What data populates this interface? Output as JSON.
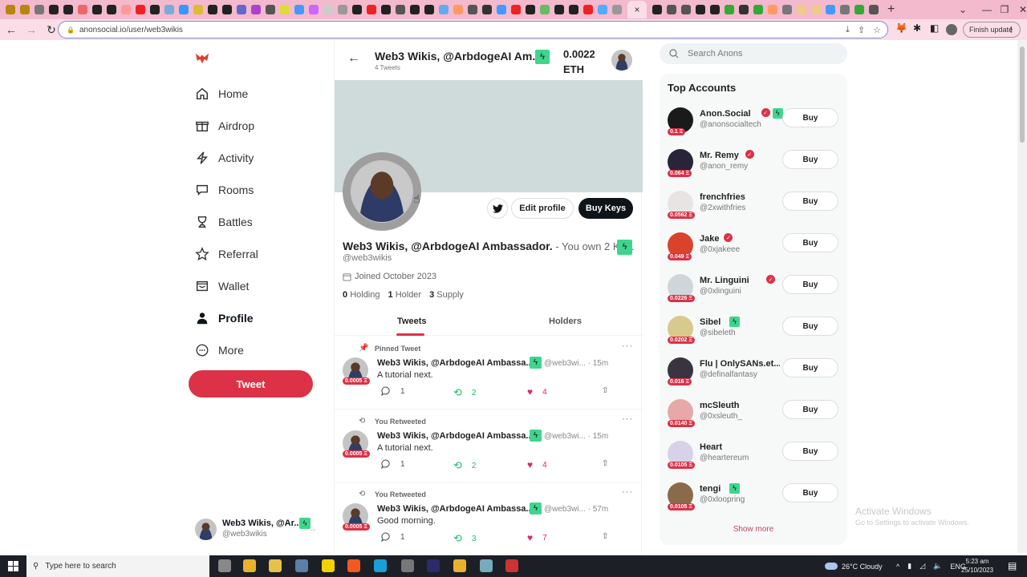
{
  "browser": {
    "url": "anonsocial.io/user/web3wikis",
    "finish_update_label": "Finish update",
    "active_tab_close": "×",
    "new_tab": "+"
  },
  "sidebar": {
    "items": [
      {
        "label": "Home",
        "icon": "home-icon"
      },
      {
        "label": "Airdrop",
        "icon": "gift-icon"
      },
      {
        "label": "Activity",
        "icon": "lightning-icon"
      },
      {
        "label": "Rooms",
        "icon": "chat-bubble-icon"
      },
      {
        "label": "Battles",
        "icon": "trophy-icon"
      },
      {
        "label": "Referral",
        "icon": "star-icon"
      },
      {
        "label": "Wallet",
        "icon": "wallet-icon"
      },
      {
        "label": "Profile",
        "icon": "user-icon",
        "active": true
      },
      {
        "label": "More",
        "icon": "more-circle-icon"
      }
    ],
    "tweet_label": "Tweet",
    "account": {
      "name": "Web3 Wikis, @Ar...",
      "handle": "@web3wikis",
      "more": "..."
    }
  },
  "header": {
    "title": "Web3 Wikis, @ArbdogeAI Am...",
    "subtitle": "4 Tweets",
    "price": "0.0022",
    "currency": "ETH"
  },
  "profile": {
    "edit_label": "Edit profile",
    "buy_keys_label": "Buy Keys",
    "name": "Web3 Wikis, @ArbdogeAI Ambassador.",
    "own_note": " - You own 2 Ke...",
    "handle": "@web3wikis",
    "joined": "Joined October 2023",
    "stats": [
      {
        "value": "0",
        "label": "Holding"
      },
      {
        "value": "1",
        "label": "Holder"
      },
      {
        "value": "3",
        "label": "Supply"
      }
    ],
    "tabs": [
      {
        "label": "Tweets",
        "active": true
      },
      {
        "label": "Holders"
      }
    ]
  },
  "posts": [
    {
      "context": "Pinned Tweet",
      "context_icon": "pin-icon",
      "author": "Web3 Wikis, @ArbdogeAI Ambassa...",
      "handle": "@web3wi...",
      "time": "· 15m",
      "text": "A tutorial next.",
      "price": "0.0005 Ξ",
      "replies": "1",
      "retweets": "2",
      "likes": "4"
    },
    {
      "context": "You Retweeted",
      "context_icon": "retweet-icon",
      "author": "Web3 Wikis, @ArbdogeAI Ambassa...",
      "handle": "@web3wi...",
      "time": "· 15m",
      "text": "A tutorial next.",
      "price": "0.0005 Ξ",
      "replies": "1",
      "retweets": "2",
      "likes": "4"
    },
    {
      "context": "You Retweeted",
      "context_icon": "retweet-icon",
      "author": "Web3 Wikis, @ArbdogeAI Ambassa...",
      "handle": "@web3wi...",
      "time": "· 57m",
      "text": "Good morning.",
      "price": "0.0005 Ξ",
      "replies": "1",
      "retweets": "3",
      "likes": "7"
    }
  ],
  "right": {
    "search_placeholder": "Search Anons",
    "top_title": "Top Accounts",
    "buy_label": "Buy",
    "show_more": "Show more",
    "accounts": [
      {
        "name": "Anon.Social",
        "handle": "@anonsocialtech",
        "price": "0.1 Ξ",
        "verified": true,
        "bolt": true,
        "color": "#1a1a1a"
      },
      {
        "name": "Mr. Remy",
        "handle": "@anon_remy",
        "price": "0.064 Ξ",
        "verified": true,
        "bolt": false,
        "color": "#2a2438"
      },
      {
        "name": "frenchfries",
        "handle": "@2xwithfries",
        "price": "0.0562 Ξ",
        "verified": false,
        "bolt": false,
        "color": "#e9e4e4"
      },
      {
        "name": "Jake",
        "handle": "@0xjakeee",
        "price": "0.049 Ξ",
        "verified": true,
        "bolt": false,
        "color": "#d9432b"
      },
      {
        "name": "Mr. Linguini",
        "handle": "@0xlinguini",
        "price": "0.0226 Ξ",
        "verified": true,
        "bolt": false,
        "color": "#cfd6da"
      },
      {
        "name": "Sibel",
        "handle": "@sibeleth",
        "price": "0.0202 Ξ",
        "verified": false,
        "bolt": true,
        "color": "#d8c98d"
      },
      {
        "name": "Flu | OnlySANs.et...",
        "handle": "@definalfantasy",
        "price": "0.016 Ξ",
        "verified": false,
        "bolt": false,
        "color": "#3a3440"
      },
      {
        "name": "mcSleuth",
        "handle": "@0xsleuth_",
        "price": "0.0140 Ξ",
        "verified": false,
        "bolt": false,
        "color": "#e6a8a8"
      },
      {
        "name": "Heart",
        "handle": "@heartereum",
        "price": "0.0105 Ξ",
        "verified": false,
        "bolt": false,
        "color": "#d7d2ea"
      },
      {
        "name": "tengi",
        "handle": "@0xloopring",
        "price": "0.0105 Ξ",
        "verified": false,
        "bolt": true,
        "color": "#8a6a4a"
      }
    ]
  },
  "watermark": {
    "line1": "Activate Windows",
    "line2": "Go to Settings to activate Windows."
  },
  "taskbar": {
    "search_placeholder": "Type here to search",
    "weather": "26°C  Cloudy",
    "lang": "ENG",
    "time": "5:23 am",
    "date": "25/10/2023"
  },
  "colors": {
    "brand": "#dc3146",
    "bolt": "#3fd58c",
    "retweet": "#17bf63",
    "like": "#e0245e"
  }
}
